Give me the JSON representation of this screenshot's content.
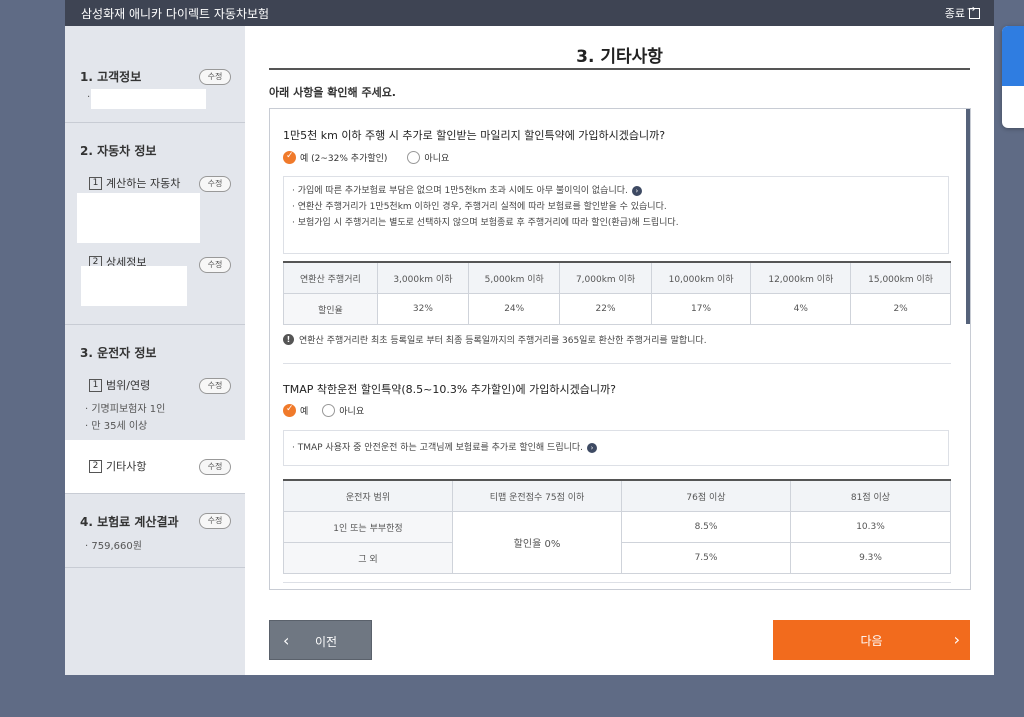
{
  "app": {
    "title": "삼성화재 애니카 다이렉트 자동차보험",
    "exit_label": "종료"
  },
  "sidebar": {
    "sections": [
      {
        "title": "1. 고객정보",
        "edit": "수정"
      },
      {
        "title": "2. 자동차 정보",
        "items": [
          {
            "num": "1",
            "label": "계산하는 자동차",
            "edit": "수정"
          },
          {
            "num": "2",
            "label": "상세정보",
            "edit": "수정"
          }
        ]
      },
      {
        "title": "3. 운전자 정보",
        "items": [
          {
            "num": "1",
            "label": "범위/연령",
            "edit": "수정",
            "details": [
              "· 기명피보험자 1인",
              "· 만 35세 이상"
            ]
          },
          {
            "num": "2",
            "label": "기타사항",
            "edit": "수정"
          }
        ]
      },
      {
        "title": "4. 보험료 계산결과",
        "edit": "수정",
        "details": [
          "· 759,660원"
        ]
      }
    ]
  },
  "main": {
    "title": "3. 기타사항",
    "confirm_msg": "아래 사항을 확인해 주세요.",
    "q1": {
      "title": "1만5천 km 이하 주행 시 추가로 할인받는 마일리지 할인특약에 가입하시겠습니까?",
      "yes": "예 (2~32% 추가할인)",
      "no": "아니요",
      "info": [
        "· 가입에 따른 추가보험료 부담은 없으며 1만5천km 초과 시에도 아무 불이익이 없습니다.",
        "· 연환산 주행거리가 1만5천km 이하인 경우, 주행거리 실적에 따라 보험료를 할인받을 수 있습니다.",
        "· 보험가입 시 주행거리는 별도로 선택하지 않으며 보험종료 후 주행거리에 따라 할인(환급)해 드립니다."
      ],
      "table": {
        "headers": [
          "연환산 주행거리",
          "3,000km 이하",
          "5,000km 이하",
          "7,000km 이하",
          "10,000km 이하",
          "12,000km 이하",
          "15,000km 이하"
        ],
        "row": [
          "할인율",
          "32%",
          "24%",
          "22%",
          "17%",
          "4%",
          "2%"
        ]
      },
      "notice": "연환산 주행거리란 최초 등록일로 부터 최종 등록일까지의 주행거리를 365일로 환산한 주행거리를 말합니다."
    },
    "q2": {
      "title": "TMAP 착한운전 할인특약(8.5~10.3% 추가할인)에 가입하시겠습니까?",
      "yes": "예",
      "no": "아니요",
      "info": "· TMAP 사용자 중 안전운전 하는 고객님께 보험료를 추가로 할인해 드립니다.",
      "table": {
        "headers": [
          "운전자 범위",
          "티맵 운전점수 75점 이하",
          "76점 이상",
          "81점 이상"
        ],
        "rows": [
          {
            "label": "1인 또는 부부한정",
            "v76": "8.5%",
            "v81": "10.3%"
          },
          {
            "label": "그 외",
            "v76": "7.5%",
            "v81": "9.3%"
          }
        ],
        "merged": "할인율 0%"
      }
    },
    "prev_label": "이전",
    "next_label": "다음"
  },
  "colors": {
    "accent": "#f26b1d",
    "radio_on": "#f07a2b",
    "topbar": "#3e4453",
    "backdrop": "#5f6b85"
  }
}
